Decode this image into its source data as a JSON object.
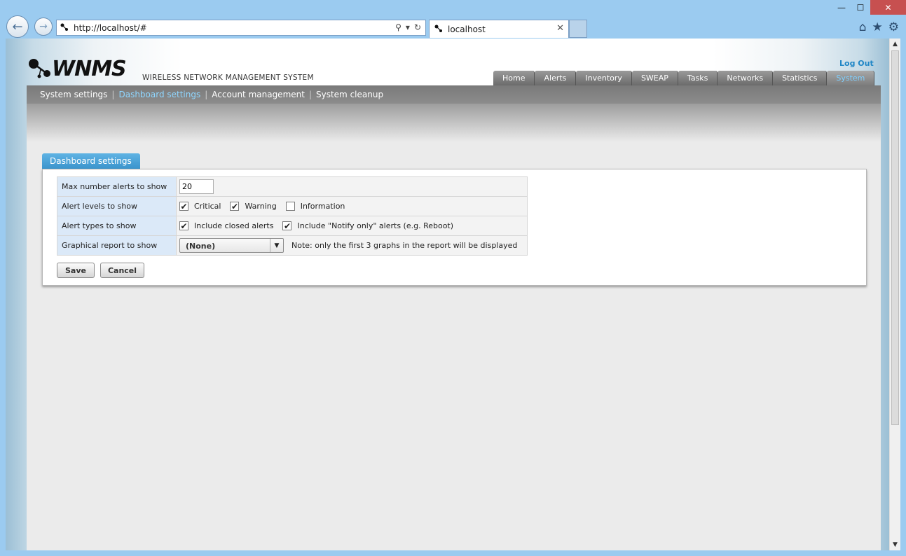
{
  "browser": {
    "address": "http://localhost/#",
    "tab_title": "localhost",
    "window_controls": {
      "minimize": "—",
      "maximize": "☐",
      "close": "✕"
    },
    "icons": [
      "back-arrow-icon",
      "forward-arrow-icon",
      "search-icon",
      "refresh-icon",
      "home-icon",
      "favorites-star-icon",
      "settings-gear-icon"
    ]
  },
  "app": {
    "logo_text": "WNMS",
    "subtitle": "WIRELESS NETWORK MANAGEMENT SYSTEM",
    "logout": "Log Out",
    "main_tabs": [
      "Home",
      "Alerts",
      "Inventory",
      "SWEAP",
      "Tasks",
      "Networks",
      "Statistics",
      "System"
    ],
    "active_tab": "System",
    "sub_nav": [
      "System settings",
      "Dashboard settings",
      "Account management",
      "System cleanup"
    ],
    "active_sub_nav": "Dashboard settings"
  },
  "panel": {
    "title": "Dashboard settings",
    "rows": {
      "max_alerts": {
        "label": "Max number alerts to show",
        "value": "20"
      },
      "alert_levels": {
        "label": "Alert levels to show",
        "options": [
          {
            "label": "Critical",
            "checked": true
          },
          {
            "label": "Warning",
            "checked": true
          },
          {
            "label": "Information",
            "checked": false
          }
        ]
      },
      "alert_types": {
        "label": "Alert types to show",
        "options": [
          {
            "label": "Include closed alerts",
            "checked": true
          },
          {
            "label": "Include \"Notify only\" alerts (e.g. Reboot)",
            "checked": true
          }
        ]
      },
      "graphical_report": {
        "label": "Graphical report to show",
        "selected": "(None)",
        "note": "Note: only the first 3 graphs in the report will be displayed"
      }
    },
    "buttons": {
      "save": "Save",
      "cancel": "Cancel"
    }
  },
  "checkmark": "✔"
}
